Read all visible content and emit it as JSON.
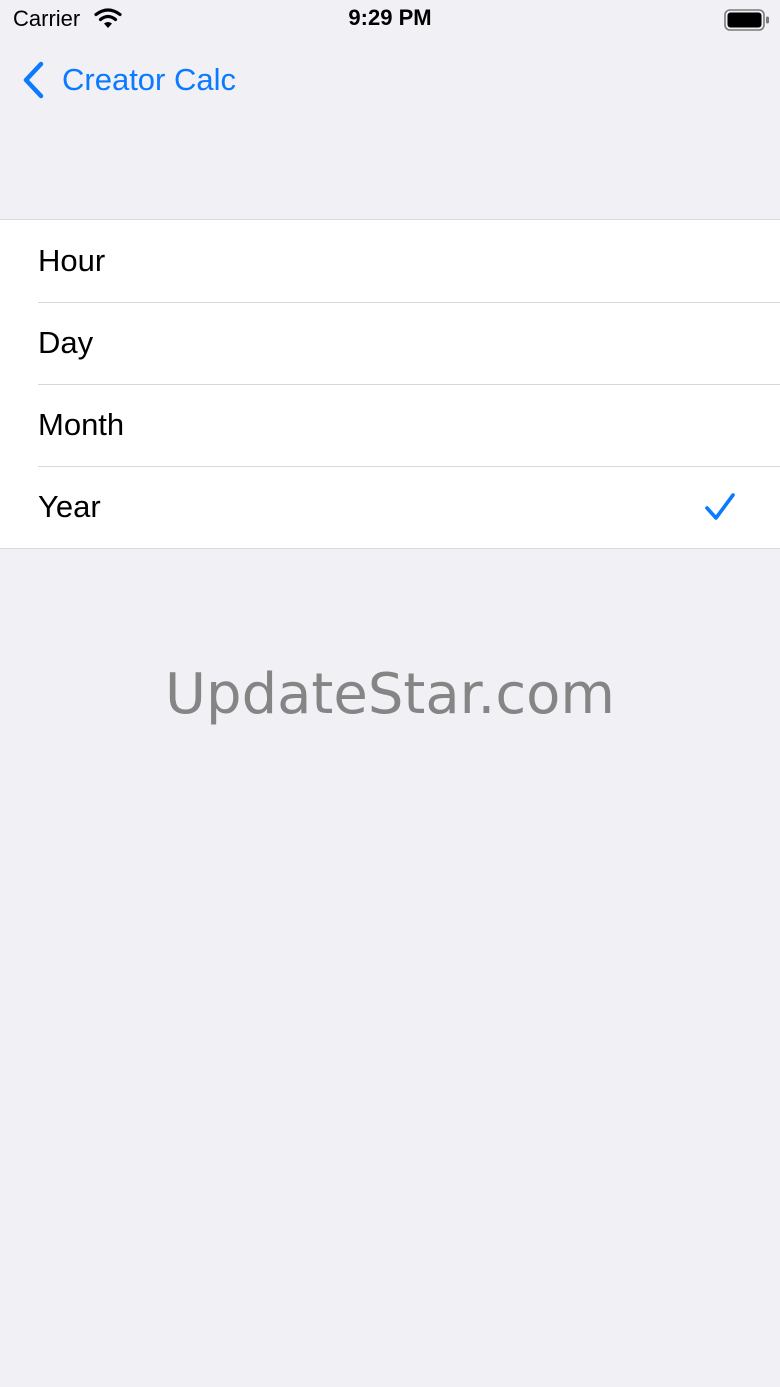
{
  "status_bar": {
    "carrier": "Carrier",
    "time": "9:29 PM"
  },
  "nav": {
    "back_label": "Creator Calc"
  },
  "options": [
    {
      "label": "Hour",
      "selected": false
    },
    {
      "label": "Day",
      "selected": false
    },
    {
      "label": "Month",
      "selected": false
    },
    {
      "label": "Year",
      "selected": true
    }
  ],
  "watermark": "UpdateStar.com",
  "colors": {
    "accent": "#0a7aff",
    "background": "#f0f0f5",
    "list_background": "#ffffff",
    "separator": "#d8d8dc",
    "watermark": "#858585"
  },
  "icons": {
    "back": "chevron-left-icon",
    "selected": "checkmark-icon",
    "wifi": "wifi-icon",
    "battery": "battery-icon"
  }
}
